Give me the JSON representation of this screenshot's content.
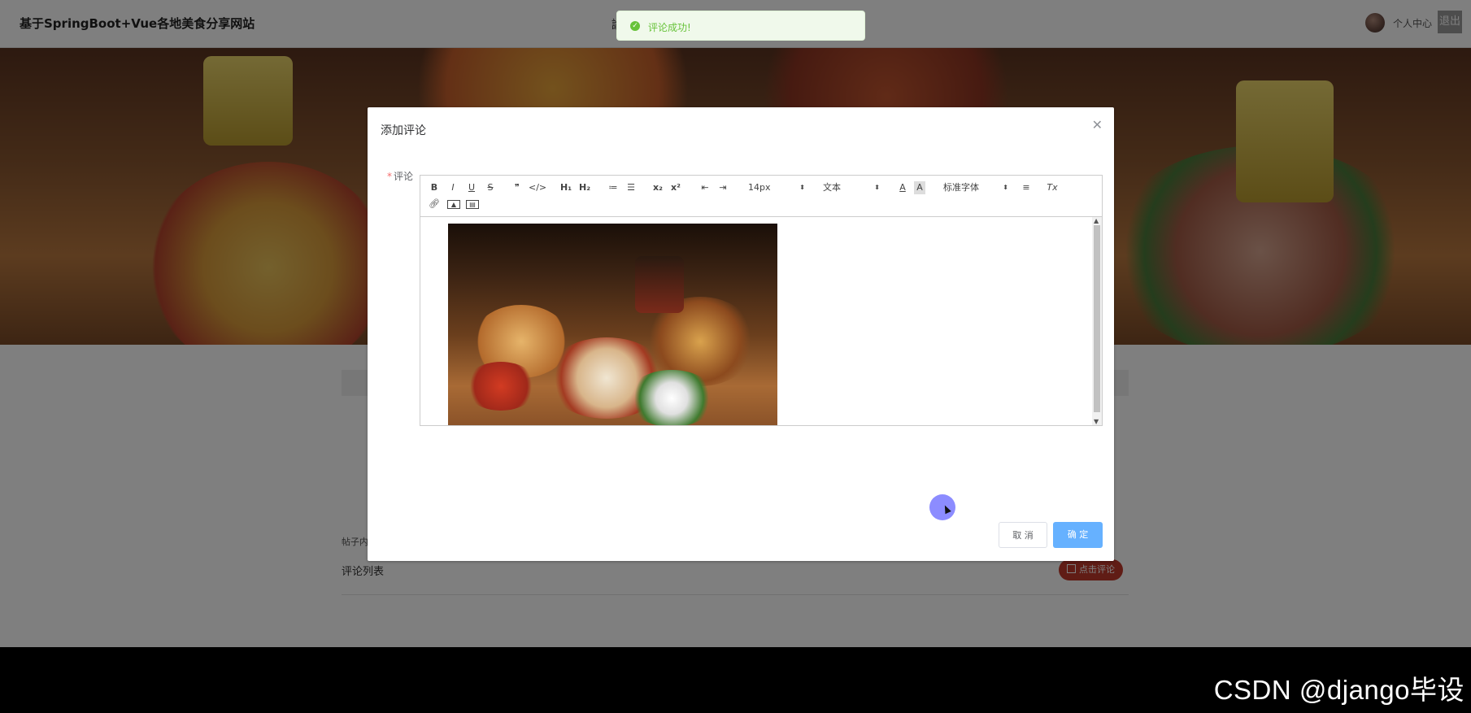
{
  "header": {
    "site_title": "基于SpringBoot+Vue各地美食分享网站",
    "nav_partial": "論",
    "user_center": "个人中心",
    "logout": "退出"
  },
  "toast": {
    "message": "评论成功!",
    "icon": "check-circle-icon"
  },
  "dialog": {
    "title": "添加评论",
    "field_label": "评论",
    "required_mark": "*",
    "cancel": "取 消",
    "confirm": "确 定"
  },
  "toolbar": {
    "bold": "B",
    "italic": "I",
    "underline": "U",
    "strike": "S",
    "quote": "❞",
    "code": "</>",
    "h1": "H₁",
    "h2": "H₂",
    "ordered_list": "≔",
    "bullet_list": "☰",
    "subscript": "x₂",
    "superscript": "x²",
    "outdent": "⇤",
    "indent": "⇥",
    "size": "14px",
    "format": "文本",
    "font": "标准字体",
    "align": "≡",
    "clean": "Tx"
  },
  "page": {
    "post_label": "帖子内",
    "comments_title": "评论列表",
    "comment_button": "点击评论"
  },
  "footer": {
    "watermark": "CSDN @django毕设"
  },
  "colors": {
    "accent": "#66b1ff",
    "success": "#67c23a",
    "danger": "#c0392b"
  }
}
